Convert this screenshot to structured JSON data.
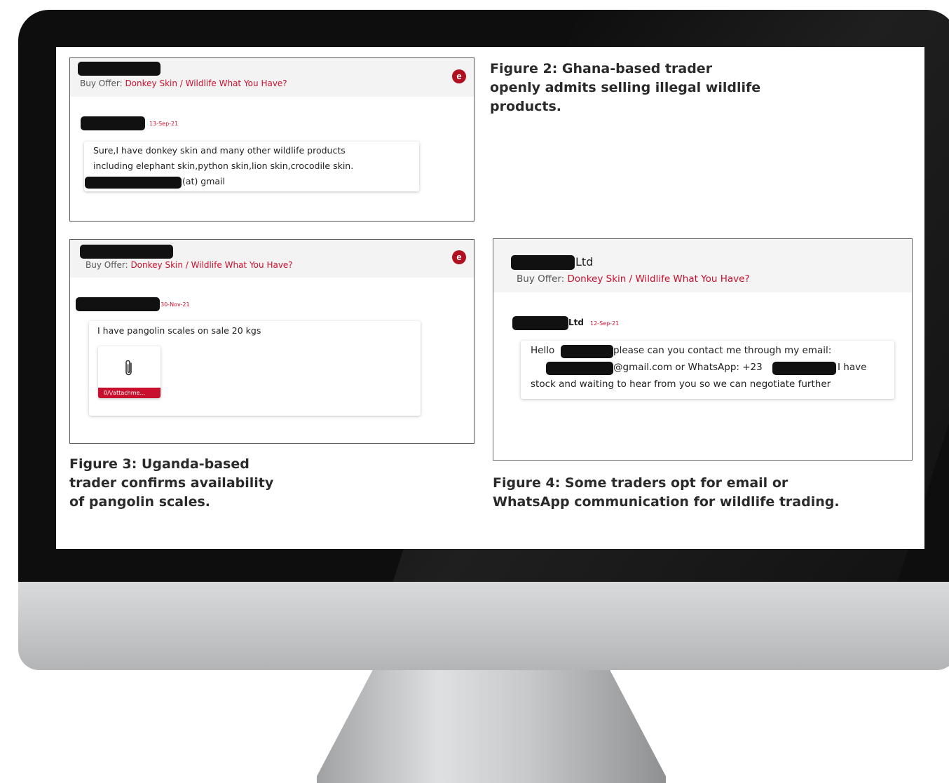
{
  "panel_a": {
    "offer_prefix": "Buy Offer: ",
    "offer_text": "Donkey Skin / Wildlife What You Have?",
    "badge": "e",
    "date": "13-Sep-21",
    "message_line1": "Sure,I have donkey skin and many other wildlife products",
    "message_line2": "including elephant skin,python skin,lion skin,crocodile skin.",
    "message_line3": "(at) gmail"
  },
  "panel_b": {
    "offer_prefix": "Buy Offer: ",
    "offer_text": "Donkey Skin / Wildlife What You Have?",
    "badge": "e",
    "date": "30-Nov-21",
    "message": "I have pangolin scales on sale 20 kgs",
    "attachment_label": "0/\\/attachme..."
  },
  "panel_c": {
    "company_suffix": "Ltd",
    "offer_prefix": "Buy Offer: ",
    "offer_text": "Donkey Skin / Wildlife What You Have?",
    "sender_suffix": "Ltd",
    "date": "12-Sep-21",
    "msg_hello": "Hello",
    "msg_line1": "please can you contact me through my email:",
    "msg_email": "@gmail.com or WhatsApp: +23",
    "msg_have": "I have",
    "msg_line3": "stock and waiting to hear from you so we can negotiate further"
  },
  "captions": {
    "fig2_line1": "Figure 2: Ghana-based trader",
    "fig2_line2": "openly admits selling illegal wildlife",
    "fig2_line3": "products.",
    "fig3_line1": "Figure 3: Uganda-based",
    "fig3_line2": "trader confirms availability",
    "fig3_line3": "of pangolin scales.",
    "fig4_line1": "Figure 4: Some traders opt for email or",
    "fig4_line2": "WhatsApp communication for wildlife trading."
  },
  "colors": {
    "accent_red": "#c8102e",
    "badge_red": "#b01020",
    "redaction": "#111111",
    "bezel": "#0e0e0f"
  },
  "icons": {
    "badge": "e-badge-icon",
    "attachment": "paperclip-icon"
  }
}
